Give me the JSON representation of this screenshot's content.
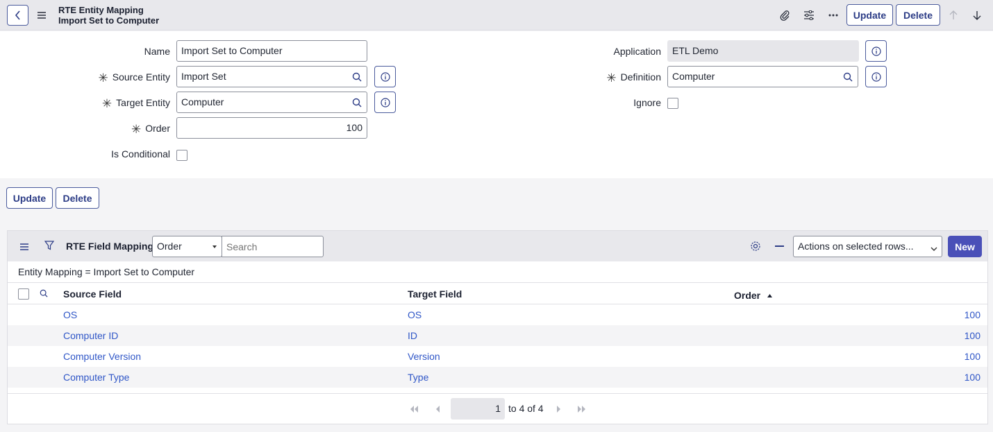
{
  "header": {
    "title_line1": "RTE Entity Mapping",
    "title_line2": "Import Set to Computer",
    "update_label": "Update",
    "delete_label": "Delete"
  },
  "form": {
    "name": {
      "label": "Name",
      "value": "Import Set to Computer"
    },
    "source_entity": {
      "label": "Source Entity",
      "value": "Import Set"
    },
    "target_entity": {
      "label": "Target Entity",
      "value": "Computer"
    },
    "order": {
      "label": "Order",
      "value": "100"
    },
    "is_conditional": {
      "label": "Is Conditional"
    },
    "application": {
      "label": "Application",
      "value": "ETL Demo"
    },
    "definition": {
      "label": "Definition",
      "value": "Computer"
    },
    "ignore": {
      "label": "Ignore"
    },
    "required_marker": "✳"
  },
  "form_buttons": {
    "update_label": "Update",
    "delete_label": "Delete"
  },
  "related_list": {
    "title": "RTE Field Mappings",
    "search_field_select": "Order",
    "search_placeholder": "Search",
    "actions_select": "Actions on selected rows...",
    "new_label": "New",
    "breadcrumb": "Entity Mapping = Import Set to Computer",
    "columns": [
      "Source Field",
      "Target Field",
      "Order"
    ],
    "rows": [
      {
        "source": "OS",
        "target": "OS",
        "order": "100"
      },
      {
        "source": "Computer ID",
        "target": "ID",
        "order": "100"
      },
      {
        "source": "Computer Version",
        "target": "Version",
        "order": "100"
      },
      {
        "source": "Computer Type",
        "target": "Type",
        "order": "100"
      }
    ],
    "pager": {
      "current": "1",
      "of_text": "to 4 of 4"
    }
  },
  "colors": {
    "accent": "#4a50b8",
    "link": "#2f56c7",
    "border": "#4a5a9c"
  }
}
